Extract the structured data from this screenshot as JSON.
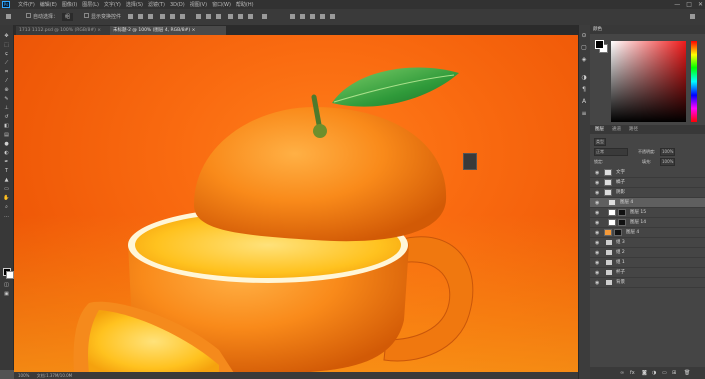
{
  "app": {
    "name": "Photoshop",
    "logo_text": "Ps"
  },
  "menu": {
    "items": [
      "文件(F)",
      "编辑(E)",
      "图像(I)",
      "图层(L)",
      "文字(Y)",
      "选择(S)",
      "滤镜(T)",
      "3D(D)",
      "视图(V)",
      "窗口(W)",
      "帮助(H)"
    ]
  },
  "window_controls": {
    "minimize": "—",
    "maximize": "□",
    "close": "✕"
  },
  "options": {
    "auto_select_label": "自动选择：",
    "layer_dropdown": "组",
    "transform_label": "显示变换控件"
  },
  "tabs": [
    {
      "label": "1713 1112.psd @ 100% (RGB/8#) ×"
    },
    {
      "label": "未标题-2 @ 100% (图层 4, RGB/8#) ×"
    }
  ],
  "status": {
    "zoom": "100%",
    "doc": "文档:1.37M/10.0M"
  },
  "panels": {
    "color_tab": "颜色"
  },
  "layers_panel": {
    "tabs": [
      "图层",
      "通道",
      "路径"
    ],
    "filter_label": "类型",
    "blend_mode": "正常",
    "opacity_label": "不透明度:",
    "opacity_value": "100%",
    "lock_label": "锁定:",
    "fill_label": "填充:",
    "fill_value": "100%",
    "layers": [
      {
        "name": "文字",
        "type": "layer"
      },
      {
        "name": "橘子",
        "type": "layer"
      },
      {
        "name": "阴影",
        "type": "layer"
      },
      {
        "name": "图层 4",
        "type": "layer",
        "selected": true
      },
      {
        "name": "图层 15",
        "type": "layer"
      },
      {
        "name": "图层 14",
        "type": "layer"
      },
      {
        "name": "图层 4",
        "type": "layer"
      },
      {
        "name": "组 3",
        "type": "group"
      },
      {
        "name": "组 2",
        "type": "group"
      },
      {
        "name": "组 1",
        "type": "group"
      },
      {
        "name": "杯子",
        "type": "group"
      },
      {
        "name": "背景",
        "type": "group"
      }
    ]
  },
  "colors": {
    "accent": "#31a8ff",
    "canvas_bg": "#f26a0e"
  }
}
